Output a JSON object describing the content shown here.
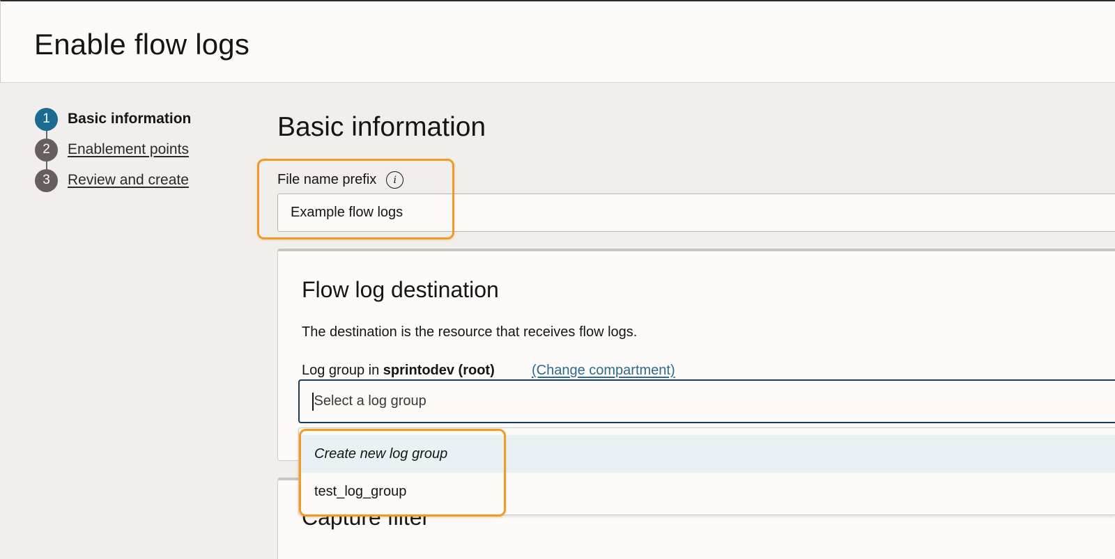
{
  "header": {
    "title": "Enable flow logs"
  },
  "stepper": {
    "steps": [
      {
        "number": "1",
        "label": "Basic information"
      },
      {
        "number": "2",
        "label": "Enablement points"
      },
      {
        "number": "3",
        "label": "Review and create"
      }
    ]
  },
  "main": {
    "section_title": "Basic information",
    "file_prefix": {
      "label": "File name prefix",
      "info_icon": "info-icon",
      "value": "Example flow logs"
    },
    "destination": {
      "title": "Flow log destination",
      "description": "The destination is the resource that receives flow logs.",
      "log_group_label_prefix": "Log group in",
      "compartment": "sprintodev (root)",
      "change_link": "(Change compartment)",
      "select_placeholder": "Select a log group",
      "options": [
        "Create new log group",
        "test_log_group"
      ]
    },
    "next_section_title": "Capture filter"
  },
  "colors": {
    "accent": "#1a6b8f",
    "highlight": "#f19a26",
    "link": "#2c6a8c",
    "focus_border": "#1d3b54"
  }
}
